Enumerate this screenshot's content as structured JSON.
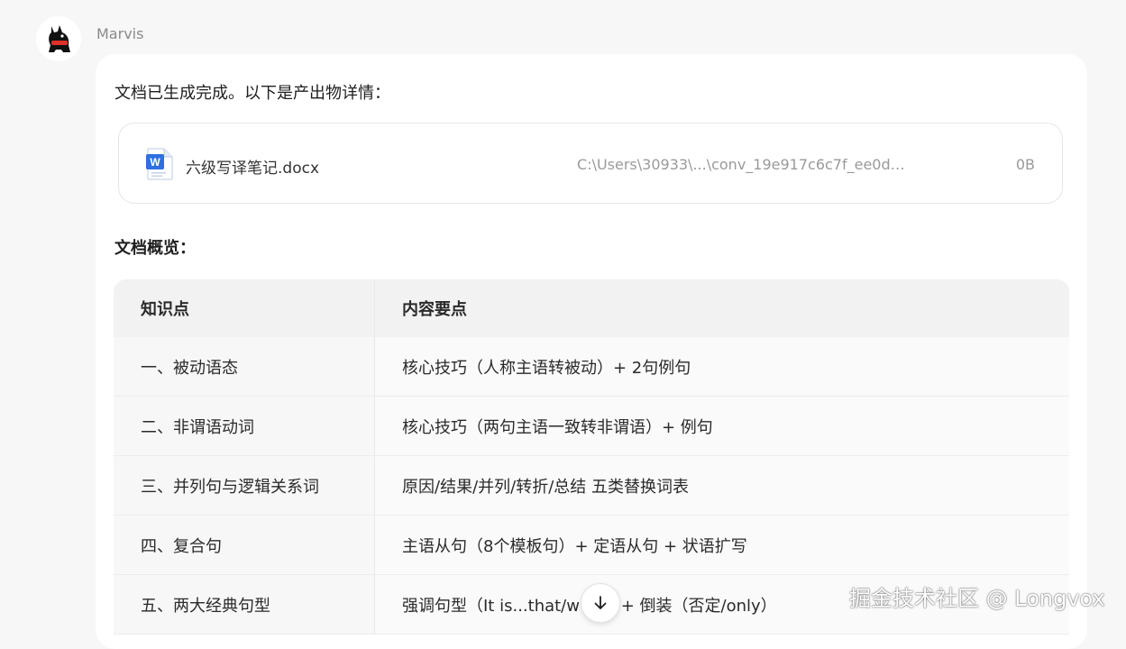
{
  "message": {
    "sender": "Marvis",
    "intro": "文档已生成完成。以下是产出物详情：",
    "file": {
      "icon": "word-doc-icon",
      "icon_letter": "W",
      "name": "六级写译笔记.docx",
      "path": "C:\\Users\\30933\\...\\conv_19e917c6c7f_ee0d…",
      "size": "0B"
    },
    "overview_title": "文档概览：",
    "table": {
      "headers": [
        "知识点",
        "内容要点"
      ],
      "rows": [
        [
          "一、被动语态",
          "核心技巧（人称主语转被动）+ 2句例句"
        ],
        [
          "二、非谓语动词",
          "核心技巧（两句主语一致转非谓语）+ 例句"
        ],
        [
          "三、并列句与逻辑关系词",
          "原因/结果/并列/转折/总结 五类替换词表"
        ],
        [
          "四、复合句",
          "主语从句（8个模板句）+ 定语从句 + 状语扩写"
        ],
        [
          "五、两大经典句型",
          "强调句型（It is...that/w        + 倒装（否定/only）"
        ]
      ]
    }
  },
  "scroll_button": {
    "icon": "arrow-down-icon"
  },
  "watermark": "掘金技术社区 @ Longvox",
  "colors": {
    "word_blue": "#2f6fe0",
    "bubble_bg": "#ffffff",
    "page_bg": "#f7f7f7"
  }
}
